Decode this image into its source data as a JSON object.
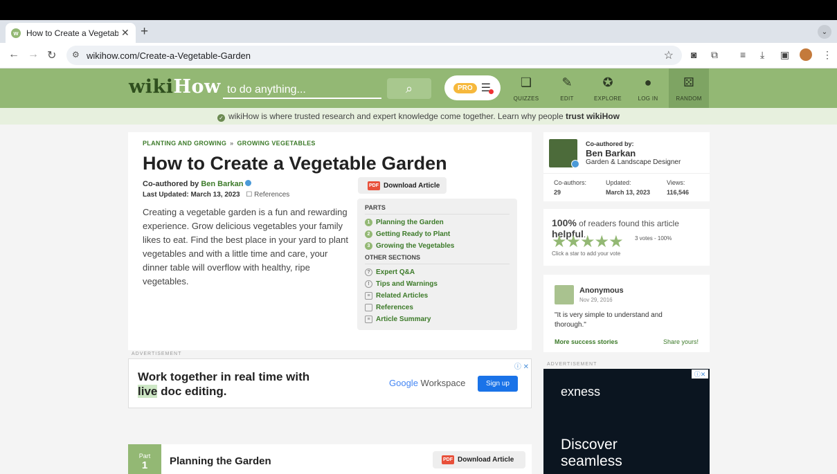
{
  "browser": {
    "tab_title": "How to Create a Vegetable G",
    "tab_close": "✕",
    "new_tab": "+",
    "url": "wikihow.com/Create-a-Vegetable-Garden"
  },
  "site": {
    "logo_wiki": "wiki",
    "logo_how": "How",
    "search_placeholder": "to do anything...",
    "pro_badge": "PRO",
    "nav": [
      {
        "label": "QUIZZES",
        "icon": "quizzes-icon"
      },
      {
        "label": "EDIT",
        "icon": "pencil-icon"
      },
      {
        "label": "EXPLORE",
        "icon": "compass-icon"
      },
      {
        "label": "LOG IN",
        "icon": "user-icon"
      },
      {
        "label": "RANDOM",
        "icon": "dice-icon"
      }
    ],
    "trust_text": "wikiHow is where trusted research and expert knowledge come together. Learn why people",
    "trust_link": "trust wikiHow"
  },
  "article": {
    "breadcrumb": [
      "PLANTING AND GROWING",
      "GROWING VEGETABLES"
    ],
    "breadcrumb_sep": "»",
    "title": "How to Create a Vegetable Garden",
    "coauthored_label": "Co-authored by",
    "author": "Ben Barkan",
    "last_updated": "Last Updated: March 13, 2023",
    "references_label": "References",
    "intro": "Creating a vegetable garden is a fun and rewarding experience. Grow delicious vegetables your family likes to eat. Find the best place in your yard to plant vegetables and with a little time and care, your dinner table will overflow with healthy, ripe vegetables.",
    "download_label": "Download Article",
    "pdf_label": "PDF"
  },
  "toc": {
    "parts_heading": "PARTS",
    "parts": [
      {
        "num": "1",
        "label": "Planning the Garden"
      },
      {
        "num": "2",
        "label": "Getting Ready to Plant"
      },
      {
        "num": "3",
        "label": "Growing the Vegetables"
      }
    ],
    "other_heading": "OTHER SECTIONS",
    "other": [
      {
        "icon": "?",
        "label": "Expert Q&A"
      },
      {
        "icon": "!",
        "label": "Tips and Warnings"
      },
      {
        "icon": "≡",
        "label": "Related Articles"
      },
      {
        "icon": "",
        "label": "References"
      },
      {
        "icon": "≡",
        "label": "Article Summary"
      }
    ]
  },
  "ad_left": {
    "label": "ADVERTISEMENT",
    "line1": "Work together in real time with",
    "line2_live": "live",
    "line2_rest": " doc editing.",
    "google": "Google",
    "workspace": " Workspace",
    "cta": "Sign up"
  },
  "part1": {
    "part_label": "Part",
    "part_num": "1",
    "title": "Planning the Garden",
    "download_label": "Download Article"
  },
  "author_card": {
    "coauthored_by": "Co-authored by:",
    "name": "Ben Barkan",
    "role": "Garden & Landscape Designer",
    "stats": [
      {
        "label": "Co-authors:",
        "value": "29"
      },
      {
        "label": "Updated:",
        "value": "March 13, 2023"
      },
      {
        "label": "Views:",
        "value": "116,546"
      }
    ]
  },
  "rating": {
    "percent": "100%",
    "text_pre": " of readers found this article ",
    "text_bold": "helpful",
    "text_post": ".",
    "stars": "★★★★★",
    "votes": "3 votes - 100%",
    "hint": "Click a star to add your vote"
  },
  "testimonial": {
    "name": "Anonymous",
    "date": "Nov 29, 2016",
    "quote": "\"It is very simple to understand and thorough.\"",
    "more": "More success stories",
    "share": "Share yours!"
  },
  "ad_right": {
    "label": "ADVERTISEMENT",
    "brand": "exness",
    "headline": "Discover seamless"
  },
  "colors": {
    "header_green": "#93b874",
    "link_green": "#3c7a29"
  }
}
